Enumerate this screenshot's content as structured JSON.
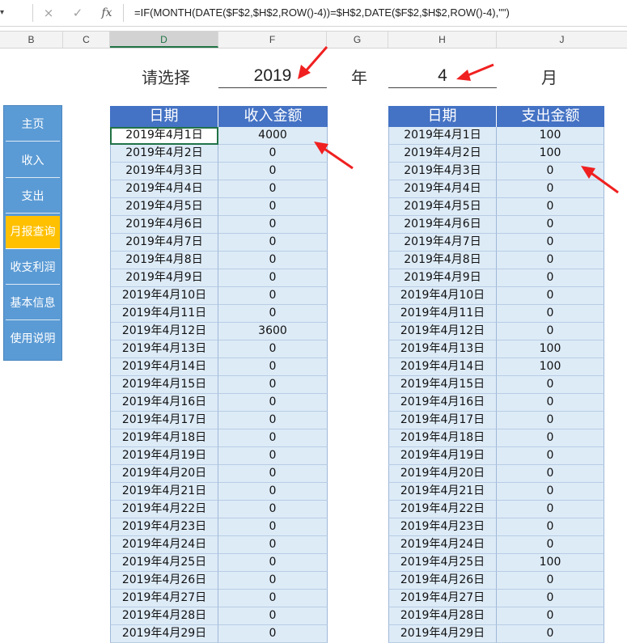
{
  "formula_bar": {
    "cancel_icon": "×",
    "confirm_icon": "✓",
    "fx_label": "fx",
    "formula": "=IF(MONTH(DATE($F$2,$H$2,ROW()-4))=$H$2,DATE($F$2,$H$2,ROW()-4),\"\")"
  },
  "columns": [
    "B",
    "C",
    "D",
    "F",
    "G",
    "H",
    "J"
  ],
  "selector": {
    "prompt": "请选择",
    "year": "2019",
    "year_unit": "年",
    "month": "4",
    "month_unit": "月"
  },
  "sidebar": {
    "items": [
      {
        "label": "主页",
        "active": false
      },
      {
        "label": "收入",
        "active": false
      },
      {
        "label": "支出",
        "active": false
      },
      {
        "label": "月报查询",
        "active": true
      },
      {
        "label": "收支利润",
        "active": false
      },
      {
        "label": "基本信息",
        "active": false
      },
      {
        "label": "使用说明",
        "active": false
      }
    ]
  },
  "income_table": {
    "headers": [
      "日期",
      "收入金额"
    ],
    "rows": [
      [
        "2019年4月1日",
        "4000"
      ],
      [
        "2019年4月2日",
        "0"
      ],
      [
        "2019年4月3日",
        "0"
      ],
      [
        "2019年4月4日",
        "0"
      ],
      [
        "2019年4月5日",
        "0"
      ],
      [
        "2019年4月6日",
        "0"
      ],
      [
        "2019年4月7日",
        "0"
      ],
      [
        "2019年4月8日",
        "0"
      ],
      [
        "2019年4月9日",
        "0"
      ],
      [
        "2019年4月10日",
        "0"
      ],
      [
        "2019年4月11日",
        "0"
      ],
      [
        "2019年4月12日",
        "3600"
      ],
      [
        "2019年4月13日",
        "0"
      ],
      [
        "2019年4月14日",
        "0"
      ],
      [
        "2019年4月15日",
        "0"
      ],
      [
        "2019年4月16日",
        "0"
      ],
      [
        "2019年4月17日",
        "0"
      ],
      [
        "2019年4月18日",
        "0"
      ],
      [
        "2019年4月19日",
        "0"
      ],
      [
        "2019年4月20日",
        "0"
      ],
      [
        "2019年4月21日",
        "0"
      ],
      [
        "2019年4月22日",
        "0"
      ],
      [
        "2019年4月23日",
        "0"
      ],
      [
        "2019年4月24日",
        "0"
      ],
      [
        "2019年4月25日",
        "0"
      ],
      [
        "2019年4月26日",
        "0"
      ],
      [
        "2019年4月27日",
        "0"
      ],
      [
        "2019年4月28日",
        "0"
      ],
      [
        "2019年4月29日",
        "0"
      ]
    ]
  },
  "expense_table": {
    "headers": [
      "日期",
      "支出金额"
    ],
    "rows": [
      [
        "2019年4月1日",
        "100"
      ],
      [
        "2019年4月2日",
        "100"
      ],
      [
        "2019年4月3日",
        "0"
      ],
      [
        "2019年4月4日",
        "0"
      ],
      [
        "2019年4月5日",
        "0"
      ],
      [
        "2019年4月6日",
        "0"
      ],
      [
        "2019年4月7日",
        "0"
      ],
      [
        "2019年4月8日",
        "0"
      ],
      [
        "2019年4月9日",
        "0"
      ],
      [
        "2019年4月10日",
        "0"
      ],
      [
        "2019年4月11日",
        "0"
      ],
      [
        "2019年4月12日",
        "0"
      ],
      [
        "2019年4月13日",
        "100"
      ],
      [
        "2019年4月14日",
        "100"
      ],
      [
        "2019年4月15日",
        "0"
      ],
      [
        "2019年4月16日",
        "0"
      ],
      [
        "2019年4月17日",
        "0"
      ],
      [
        "2019年4月18日",
        "0"
      ],
      [
        "2019年4月19日",
        "0"
      ],
      [
        "2019年4月20日",
        "0"
      ],
      [
        "2019年4月21日",
        "0"
      ],
      [
        "2019年4月22日",
        "0"
      ],
      [
        "2019年4月23日",
        "0"
      ],
      [
        "2019年4月24日",
        "0"
      ],
      [
        "2019年4月25日",
        "100"
      ],
      [
        "2019年4月26日",
        "0"
      ],
      [
        "2019年4月27日",
        "0"
      ],
      [
        "2019年4月28日",
        "0"
      ],
      [
        "2019年4月29日",
        "0"
      ]
    ]
  },
  "colors": {
    "header_bg": "#4472c4",
    "cell_bg": "#ddebf7",
    "sidebar_bg": "#5b9bd5",
    "sidebar_active": "#ffc000",
    "arrow": "#f02020"
  }
}
